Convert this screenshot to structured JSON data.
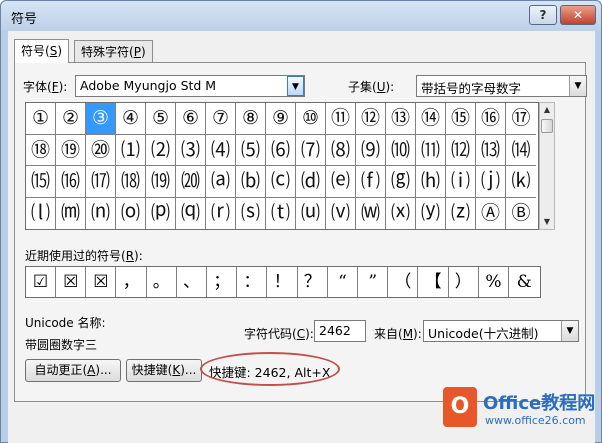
{
  "window": {
    "title": "符号",
    "help_label": "?",
    "close_label": "✕"
  },
  "tabs": [
    {
      "label": "符号(",
      "key": "S",
      "tail": ")"
    },
    {
      "label": "特殊字符(",
      "key": "P",
      "tail": ")"
    }
  ],
  "font": {
    "label": "字体(",
    "key": "F",
    "tail": "):",
    "value": "Adobe Myungjo Std M"
  },
  "subset": {
    "label": "子集(",
    "key": "U",
    "tail": "):",
    "value": "带括号的字母数字"
  },
  "symbols": [
    [
      "①",
      "②",
      "③",
      "④",
      "⑤",
      "⑥",
      "⑦",
      "⑧",
      "⑨",
      "⑩",
      "⑪",
      "⑫",
      "⑬",
      "⑭",
      "⑮",
      "⑯",
      "⑰"
    ],
    [
      "⑱",
      "⑲",
      "⑳",
      "⑴",
      "⑵",
      "⑶",
      "⑷",
      "⑸",
      "⑹",
      "⑺",
      "⑻",
      "⑼",
      "⑽",
      "⑾",
      "⑿",
      "⒀",
      "⒁"
    ],
    [
      "⒂",
      "⒃",
      "⒄",
      "⒅",
      "⒆",
      "⒇",
      "⒜",
      "⒝",
      "⒞",
      "⒟",
      "⒠",
      "⒡",
      "⒢",
      "⒣",
      "⒤",
      "⒥",
      "⒦"
    ],
    [
      "⒧",
      "⒨",
      "⒩",
      "⒪",
      "⒫",
      "⒬",
      "⒭",
      "⒮",
      "⒯",
      "⒰",
      "⒱",
      "⒲",
      "⒳",
      "⒴",
      "⒵",
      "Ⓐ",
      "Ⓑ"
    ]
  ],
  "selected_symbol": {
    "row": 0,
    "col": 2
  },
  "recent": {
    "label": "近期使用过的符号(",
    "key": "R",
    "tail": "):",
    "items": [
      "☑",
      "☒",
      "☒",
      "，",
      "。",
      "、",
      "；",
      "：",
      "！",
      "？",
      "“",
      "”",
      "（",
      "【",
      "）",
      "%",
      "&"
    ]
  },
  "unicode_name": {
    "label": "Unicode 名称:",
    "value": "带圆圈数字三"
  },
  "char_code": {
    "label": "字符代码(",
    "key": "C",
    "tail": "):",
    "value": "2462"
  },
  "from": {
    "label": "来自(",
    "key": "M",
    "tail": "):",
    "value": "Unicode(十六进制)"
  },
  "buttons": {
    "autocorrect": {
      "label": "自动更正(",
      "key": "A",
      "tail": ")..."
    },
    "shortcut": {
      "label": "快捷键(",
      "key": "K",
      "tail": ")..."
    }
  },
  "shortcut_text": "快捷键: 2462, Alt+X",
  "watermark": {
    "logo": "O",
    "title": "Office教程网",
    "sub": "www.office26.com"
  }
}
